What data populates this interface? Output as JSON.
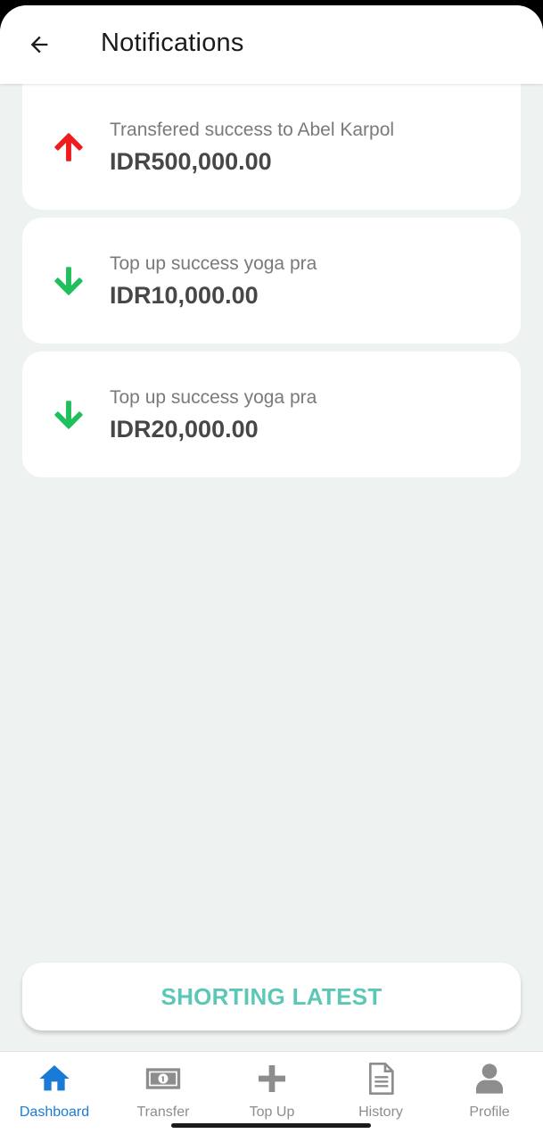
{
  "header": {
    "title": "Notifications"
  },
  "notifications": [
    {
      "direction": "up",
      "arrow_icon": "arrow-up-icon",
      "color": "#ee1c1c",
      "message": "Transfered success to Abel Karpol",
      "amount": "IDR500,000.00"
    },
    {
      "direction": "down",
      "arrow_icon": "arrow-down-icon",
      "color": "#1fbf5c",
      "message": "Top up success yoga pra",
      "amount": "IDR10,000.00"
    },
    {
      "direction": "down",
      "arrow_icon": "arrow-down-icon",
      "color": "#1fbf5c",
      "message": "Top up success yoga pra",
      "amount": "IDR20,000.00"
    }
  ],
  "sort_button": {
    "label": "SHORTING LATEST",
    "color": "#5cc7b7"
  },
  "bottom_nav": {
    "active_color": "#1a7bd6",
    "inactive_color": "#8d8d8d",
    "items": [
      {
        "label": "Dashboard",
        "icon": "home-icon",
        "active": true
      },
      {
        "label": "Transfer",
        "icon": "banknote-icon",
        "active": false
      },
      {
        "label": "Top Up",
        "icon": "plus-icon",
        "active": false
      },
      {
        "label": "History",
        "icon": "document-icon",
        "active": false
      },
      {
        "label": "Profile",
        "icon": "user-icon",
        "active": false
      }
    ]
  }
}
